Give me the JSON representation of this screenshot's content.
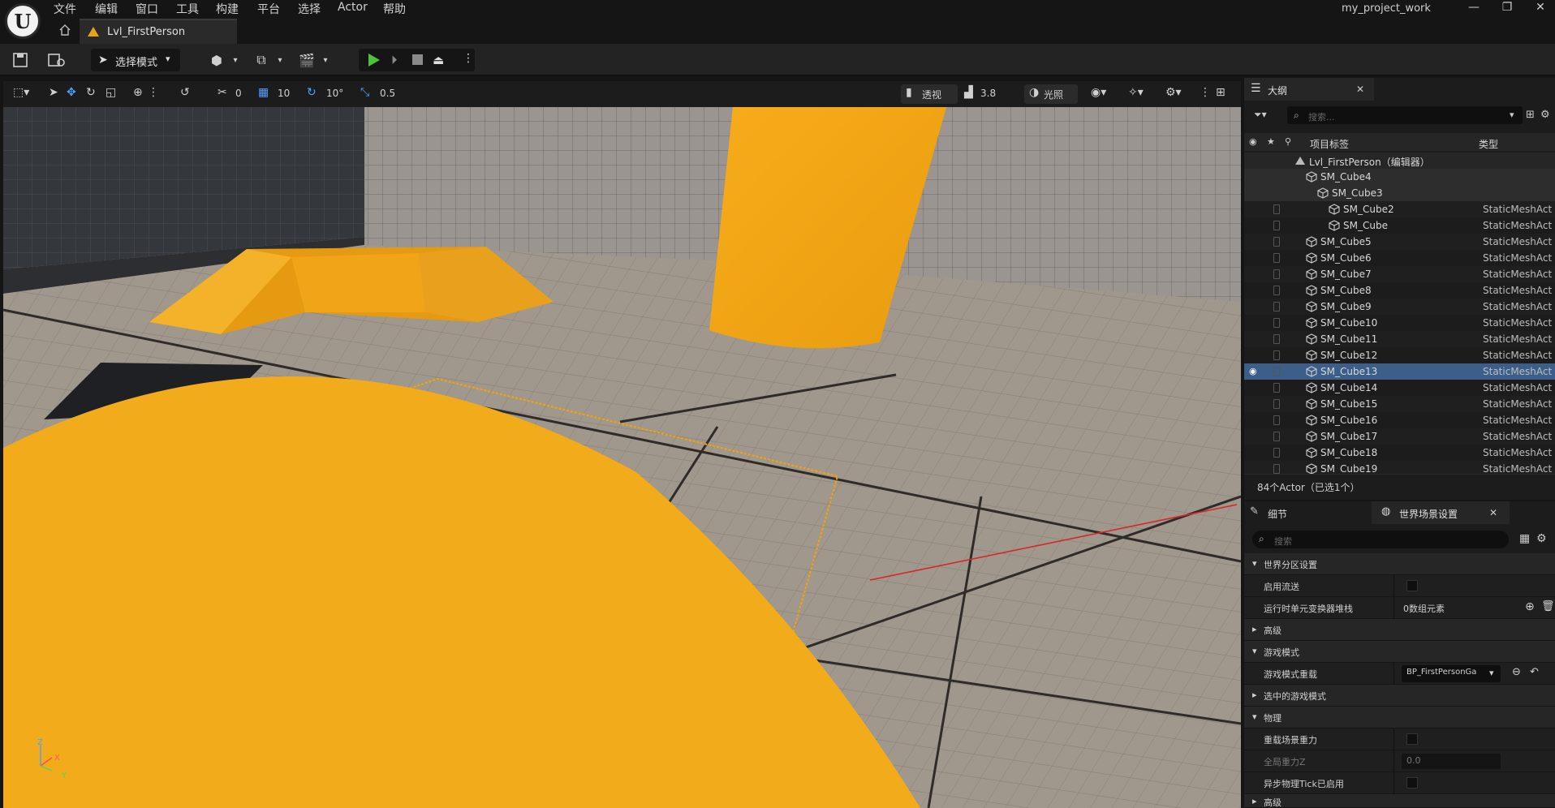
{
  "menu": [
    "文件",
    "编辑",
    "窗口",
    "工具",
    "构建",
    "平台",
    "选择",
    "Actor",
    "帮助"
  ],
  "project_name": "my_project_work",
  "level_tab": "Lvl_FirstPerson",
  "toolbar": {
    "mode_label": "选择模式"
  },
  "viewport_toolbar": {
    "rotate_snap": "0",
    "grid_snap": "10",
    "angle_snap": "10°",
    "scale_snap": "0.5",
    "view_mode": "透视",
    "camera_speed": "3.8",
    "lighting": "光照"
  },
  "axes": {
    "z": "Z",
    "x": "X",
    "y": "Y"
  },
  "outliner": {
    "title": "大纲",
    "search_placeholder": "搜索...",
    "col_label": "项目标签",
    "col_type": "类型",
    "rows": [
      {
        "name": "Lvl_FirstPerson（编辑器）",
        "type": ""
      },
      {
        "name": "SM_Cube4",
        "type": ""
      },
      {
        "name": "SM_Cube3",
        "type": ""
      },
      {
        "name": "SM_Cube2",
        "type": "StaticMeshActor"
      },
      {
        "name": "SM_Cube",
        "type": "StaticMeshActor"
      },
      {
        "name": "SM_Cube5",
        "type": "StaticMeshActor"
      },
      {
        "name": "SM_Cube6",
        "type": "StaticMeshActor"
      },
      {
        "name": "SM_Cube7",
        "type": "StaticMeshActor"
      },
      {
        "name": "SM_Cube8",
        "type": "StaticMeshActor"
      },
      {
        "name": "SM_Cube9",
        "type": "StaticMeshActor"
      },
      {
        "name": "SM_Cube10",
        "type": "StaticMeshActor"
      },
      {
        "name": "SM_Cube11",
        "type": "StaticMeshActor"
      },
      {
        "name": "SM_Cube12",
        "type": "StaticMeshActor"
      },
      {
        "name": "SM_Cube13",
        "type": "StaticMeshActor"
      },
      {
        "name": "SM_Cube14",
        "type": "StaticMeshActor"
      },
      {
        "name": "SM_Cube15",
        "type": "StaticMeshActor"
      },
      {
        "name": "SM_Cube16",
        "type": "StaticMeshActor"
      },
      {
        "name": "SM_Cube17",
        "type": "StaticMeshActor"
      },
      {
        "name": "SM_Cube18",
        "type": "StaticMeshActor"
      },
      {
        "name": "SM_Cube19",
        "type": "StaticMeshActor"
      }
    ],
    "status": "84个Actor（已选1个）"
  },
  "details": {
    "tab1": "细节",
    "tab2": "世界场景设置",
    "search_placeholder": "搜索",
    "s1": "世界分区设置",
    "p_stream": "启用流送",
    "p_stack": "运行时单元变换器堆栈",
    "p_stack_val": "0数组元素",
    "s_adv": "高级",
    "s_game": "游戏模式",
    "p_gm": "游戏模式重载",
    "p_gm_val": "BP_FirstPersonGa",
    "s_sel_gm": "选中的游戏模式",
    "s_phys": "物理",
    "p_grav": "重载场景重力",
    "p_gz": "全局重力Z",
    "p_gz_val": "0.0",
    "p_async": "异步物理Tick已启用",
    "s_more": "高级"
  }
}
